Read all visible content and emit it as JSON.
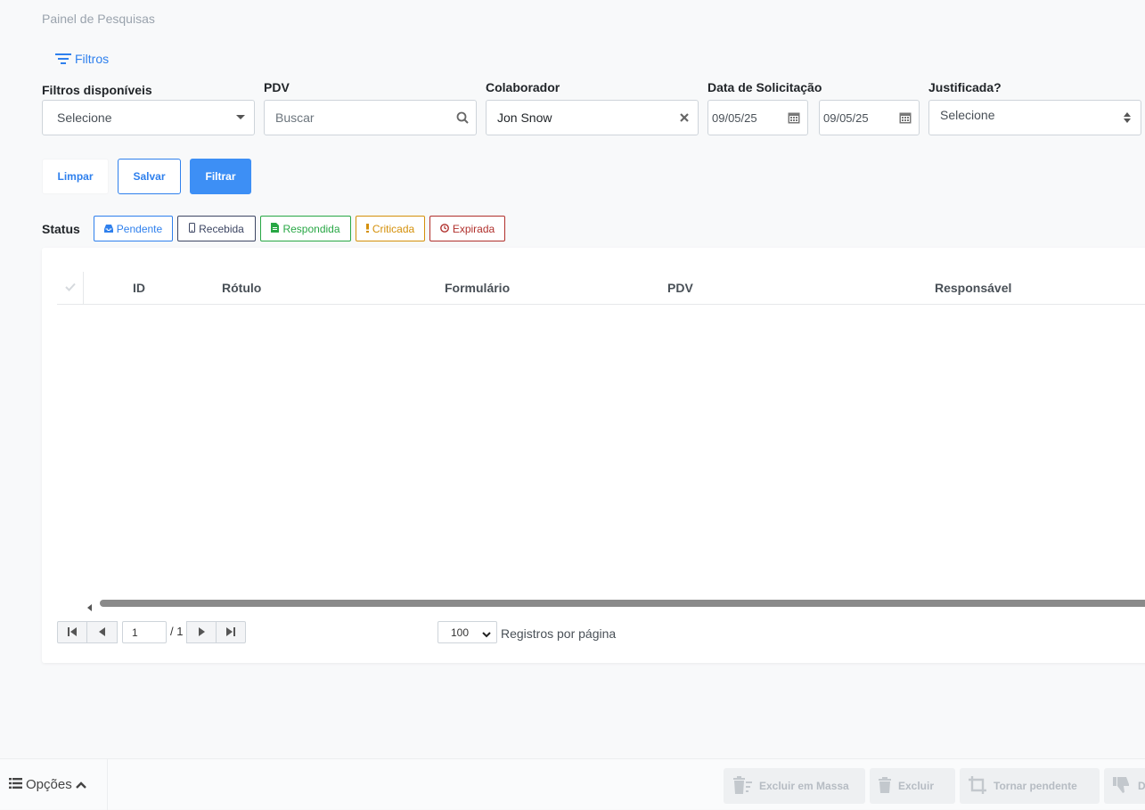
{
  "page": {
    "title": "Painel de Pesquisas"
  },
  "filters_toggle": {
    "label": "Filtros",
    "icon": "filter-lines-icon"
  },
  "filters": {
    "available": {
      "label": "Filtros disponíveis",
      "value": "Selecione"
    },
    "pdv": {
      "label": "PDV",
      "placeholder": "Buscar"
    },
    "colaborador": {
      "label": "Colaborador",
      "value": "Jon Snow"
    },
    "data_solicitacao": {
      "label": "Data de Solicitação",
      "start": "09/05/25",
      "end": "09/05/25"
    },
    "justificada": {
      "label": "Justificada?",
      "value": "Selecione"
    }
  },
  "actions": {
    "limpar": "Limpar",
    "salvar": "Salvar",
    "filtrar": "Filtrar"
  },
  "status": {
    "label": "Status",
    "chips": [
      {
        "label": "Pendente",
        "color": "#2f80ed",
        "icon": "inbox-icon"
      },
      {
        "label": "Recebida",
        "color": "#3d4663",
        "icon": "mobile-icon"
      },
      {
        "label": "Respondida",
        "color": "#28a745",
        "icon": "file-icon"
      },
      {
        "label": "Criticada",
        "color": "#d4900a",
        "icon": "exclamation-icon"
      },
      {
        "label": "Expirada",
        "color": "#b0302c",
        "icon": "clock-icon"
      }
    ]
  },
  "table": {
    "columns": [
      "ID",
      "Rótulo",
      "Formulário",
      "PDV",
      "Responsável"
    ],
    "rows": []
  },
  "pagination": {
    "current_page": "1",
    "total_pages": "/ 1",
    "per_page": "100",
    "per_page_label": "Registros por página"
  },
  "footer": {
    "options_label": "Opções",
    "buttons": [
      "Excluir em Massa",
      "Excluir",
      "Tornar pendente",
      "D"
    ]
  },
  "colors": {
    "accent": "#2f80ed",
    "primary_button": "#3d8ff5",
    "disabled_text": "#b6bcc3"
  }
}
